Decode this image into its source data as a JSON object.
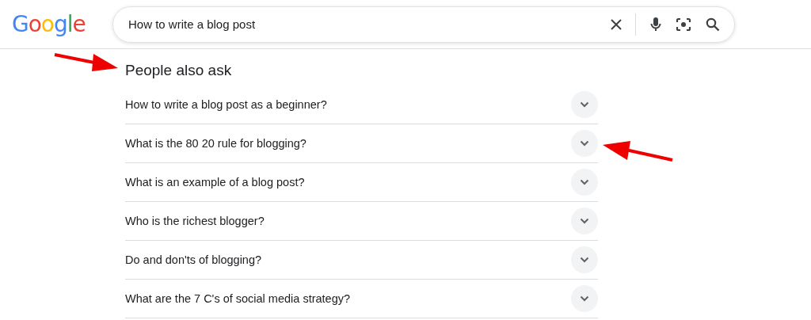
{
  "logo": "Google",
  "search": {
    "value": "How to write a blog post"
  },
  "people_also_ask": {
    "heading": "People also ask",
    "heading_marked": true,
    "questions": [
      {
        "text": "How to write a blog post as a beginner?",
        "marked": false
      },
      {
        "text": "What is the 80 20 rule for blogging?",
        "marked": true
      },
      {
        "text": "What is an example of a blog post?",
        "marked": false
      },
      {
        "text": "Who is the richest blogger?",
        "marked": false
      },
      {
        "text": "Do and don'ts of blogging?",
        "marked": false
      },
      {
        "text": "What are the 7 C's of social media strategy?",
        "marked": false
      }
    ]
  }
}
